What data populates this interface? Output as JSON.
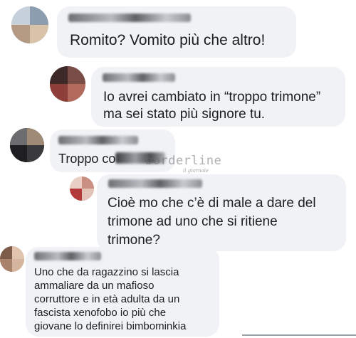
{
  "comments": [
    {
      "text": "Romito? Vomito più che altro!"
    },
    {
      "text": "Io avrei cambiato in “troppo trimone”\nma sei stato più signore tu."
    },
    {
      "text": "Troppo co"
    },
    {
      "text": "Cioè mo che c’è di male a dare del\ntrimone ad uno che si ritiene\ntrimone?"
    },
    {
      "text": "Uno che da ragazzino si lascia\nammaliare da un mafioso\ncorruttore e in età adulta da un\nfascista xenofobo io più che\ngiovane lo definirei bimbominkia"
    }
  ],
  "watermark": {
    "main": "borderline",
    "sub": "il giornale"
  },
  "colors": {
    "bubble": "#f0f2f5",
    "text": "#1c1e21"
  }
}
